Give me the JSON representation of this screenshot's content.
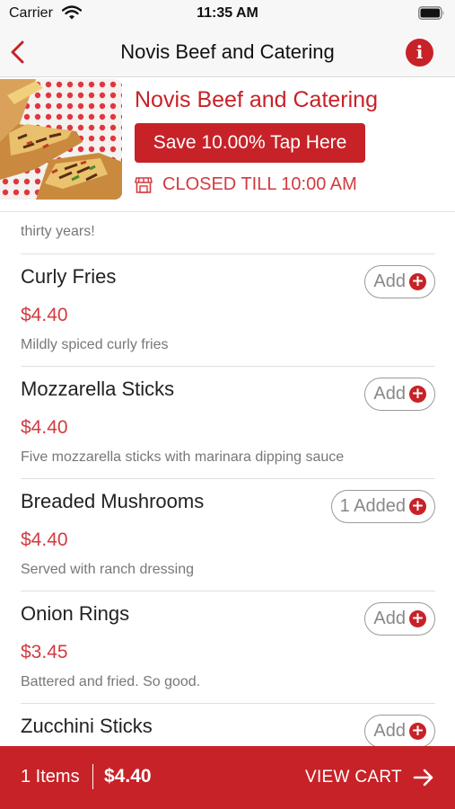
{
  "status_bar": {
    "carrier": "Carrier",
    "time": "11:35 AM"
  },
  "nav": {
    "title": "Novis Beef and Catering",
    "back_icon": "chevron-left-icon",
    "info_icon": "info-icon",
    "info_glyph": "i"
  },
  "header": {
    "restaurant_name": "Novis Beef and Catering",
    "save_label": "Save 10.00% Tap Here",
    "closed_label": "CLOSED TILL 10:00 AM",
    "store_icon": "store-icon"
  },
  "menu": {
    "intro_text": "thirty years!",
    "items": [
      {
        "name": "Curly Fries",
        "price": "$4.40",
        "description": "Mildly spiced curly fries",
        "button": "Add"
      },
      {
        "name": "Mozzarella Sticks",
        "price": "$4.40",
        "description": "Five mozzarella sticks with marinara dipping sauce",
        "button": "Add"
      },
      {
        "name": "Breaded Mushrooms",
        "price": "$4.40",
        "description": "Served with ranch dressing",
        "button": "1 Added"
      },
      {
        "name": "Onion Rings",
        "price": "$3.45",
        "description": "Battered and fried.  So good.",
        "button": "Add"
      },
      {
        "name": "Zucchini Sticks",
        "price": "",
        "description": "",
        "button": "Add"
      }
    ],
    "plus_glyph": "+"
  },
  "cart": {
    "items_label": "1 Items",
    "total": "$4.40",
    "view_cart_label": "VIEW CART"
  },
  "colors": {
    "brand_red": "#c72228",
    "price_red": "#d33a3f",
    "muted_text": "#777777",
    "nav_background": "#f7f7f7"
  }
}
